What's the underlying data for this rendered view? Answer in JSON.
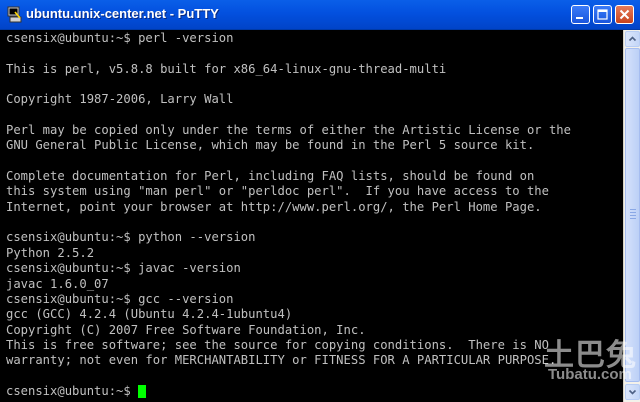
{
  "window": {
    "title": "ubuntu.unix-center.net - PuTTY",
    "app_icon": "putty-icon",
    "buttons": {
      "minimize_icon": "minimize-icon",
      "maximize_icon": "maximize-icon",
      "close_icon": "close-icon"
    },
    "colors": {
      "titlebar": "#0350df",
      "terminal_bg": "#000000",
      "terminal_fg": "#c0c0c0",
      "cursor": "#00ff00"
    }
  },
  "terminal": {
    "lines": [
      "csensix@ubuntu:~$ perl -version",
      "",
      "This is perl, v5.8.8 built for x86_64-linux-gnu-thread-multi",
      "",
      "Copyright 1987-2006, Larry Wall",
      "",
      "Perl may be copied only under the terms of either the Artistic License or the",
      "GNU General Public License, which may be found in the Perl 5 source kit.",
      "",
      "Complete documentation for Perl, including FAQ lists, should be found on",
      "this system using \"man perl\" or \"perldoc perl\".  If you have access to the",
      "Internet, point your browser at http://www.perl.org/, the Perl Home Page.",
      "",
      "csensix@ubuntu:~$ python --version",
      "Python 2.5.2",
      "csensix@ubuntu:~$ javac -version",
      "javac 1.6.0_07",
      "csensix@ubuntu:~$ gcc --version",
      "gcc (GCC) 4.2.4 (Ubuntu 4.2.4-1ubuntu4)",
      "Copyright (C) 2007 Free Software Foundation, Inc.",
      "This is free software; see the source for copying conditions.  There is NO",
      "warranty; not even for MERCHANTABILITY or FITNESS FOR A PARTICULAR PURPOSE.",
      ""
    ],
    "prompt": "csensix@ubuntu:~$ "
  },
  "watermark": {
    "cn": "土巴兔",
    "en": "Tubatu.com"
  }
}
